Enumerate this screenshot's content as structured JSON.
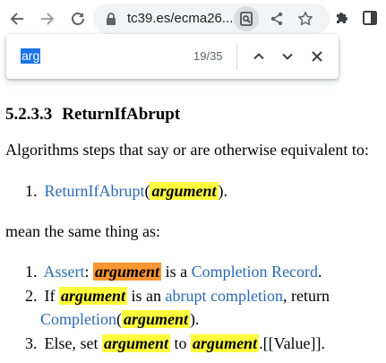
{
  "browser": {
    "url": "tc39.es/ecma26",
    "url_suffix": "...",
    "icons": [
      "back-arrow-icon",
      "forward-arrow-icon",
      "reload-icon",
      "lock-icon",
      "zoom-icon",
      "share-icon",
      "star-icon",
      "extensions-icon",
      "side-panel-icon"
    ]
  },
  "find": {
    "query": "arg",
    "count": "19/35"
  },
  "section": {
    "number": "5.2.3.3",
    "title": "ReturnIfAbrupt"
  },
  "intro": "Algorithms steps that say or are otherwise equivalent to:",
  "step0": {
    "num": "1.",
    "link": "ReturnIfAbrupt",
    "open": "(",
    "var": "argument",
    "close": ")."
  },
  "mean": "mean the same thing as:",
  "steps": [
    {
      "num": "1.",
      "link": "Assert",
      "colon": ": ",
      "var": "argument",
      "text": " is a ",
      "link2": "Completion Record",
      "end": "."
    },
    {
      "num": "2.",
      "text1": "If ",
      "var": "argument",
      "text2": " is an ",
      "link": "abrupt completion",
      "text3": ", return",
      "link2": "Completion",
      "open": "(",
      "var2": "argument",
      "close": ")."
    },
    {
      "num": "3.",
      "text1": "Else, set ",
      "var": "argument",
      "text2": " to ",
      "var2": "argument",
      "text3": ".[[Value]]."
    }
  ],
  "colors": {
    "link": "#2a6ab2",
    "highlight": "#ffff3d",
    "current_highlight": "#ff9632",
    "find_selection": "#1a73e8"
  }
}
